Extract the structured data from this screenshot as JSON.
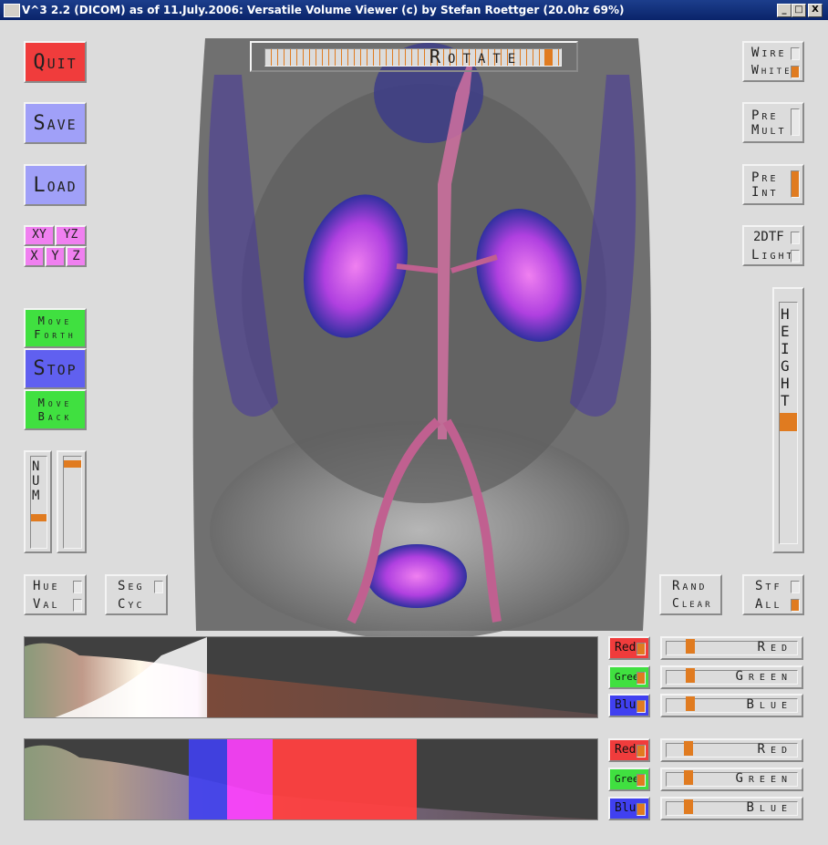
{
  "window": {
    "title": "V^3 2.2 (DICOM) as of 11.July.2006: Versatile Volume Viewer (c) by Stefan Roettger (20.0hz 69%)",
    "minimize": "_",
    "maximize": "□",
    "close": "X"
  },
  "left": {
    "quit": "Quit",
    "save": "Save",
    "load": "Load",
    "xy": "XY",
    "yz": "YZ",
    "x": "X",
    "y": "Y",
    "z": "Z",
    "move_forth_1": "Move",
    "move_forth_2": "Forth",
    "stop": "Stop",
    "move_back_1": "Move",
    "move_back_2": "Back",
    "num_chars": [
      "N",
      "U",
      "M"
    ],
    "num_level": 0.3,
    "slider2_level": 0.95,
    "hue": "Hue",
    "val": "Val",
    "seg": "Seg",
    "cyc": "Cyc"
  },
  "top": {
    "rotate": "Rotate",
    "rotate_level": 0.97
  },
  "right": {
    "wire": "Wire",
    "white": "White",
    "pre": "Pre",
    "mult": "Mult",
    "pre2": "Pre",
    "int": "Int",
    "tf2d": "2DTF",
    "light": "Light",
    "height_chars": [
      "H",
      "E",
      "I",
      "G",
      "H",
      "T"
    ],
    "height_level": 0.5,
    "rand": "Rand",
    "clear": "Clear",
    "stf": "Stf",
    "all": "All"
  },
  "tf1": {
    "red_label": "Red",
    "green_label": "Green",
    "blue_label": "Blue",
    "red_slider": "Red",
    "green_slider": "Green",
    "blue_slider": "Blue",
    "red_level": 0.15,
    "green_level": 0.15,
    "blue_level": 0.15
  },
  "tf2": {
    "red_label": "Red",
    "green_label": "Green",
    "blue_label": "Blue",
    "red_slider": "Red",
    "green_slider": "Green",
    "blue_slider": "Blue",
    "red_level": 0.13,
    "green_level": 0.13,
    "blue_level": 0.13
  },
  "colors": {
    "quit": "#f03c3c",
    "save_load": "#a0a0f8",
    "xyz": "#f080f0",
    "move": "#40e040",
    "stop": "#6060f0",
    "red": "#f03c3c",
    "green": "#40e040",
    "blue": "#4040f0",
    "accent": "#e07b20"
  }
}
